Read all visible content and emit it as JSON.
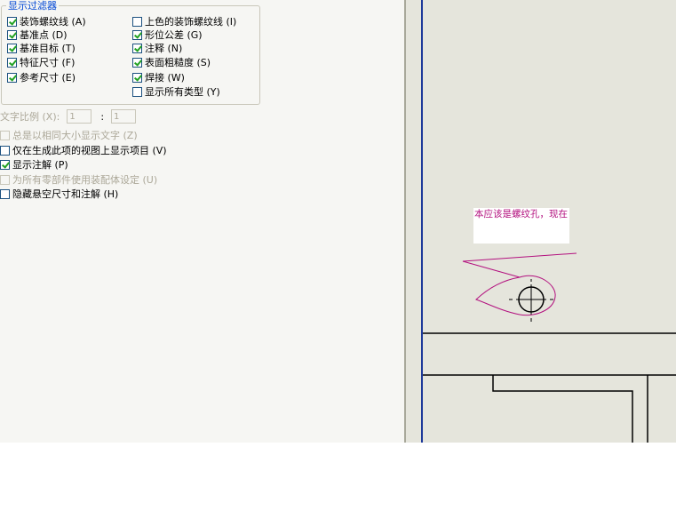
{
  "display_filter": {
    "title": "显示过滤器",
    "left_items": [
      {
        "label": "装饰螺纹线 (A)",
        "checked": true
      },
      {
        "label": "基准点 (D)",
        "checked": true
      },
      {
        "label": "基准目标 (T)",
        "checked": true
      },
      {
        "label": "特征尺寸 (F)",
        "checked": true
      },
      {
        "label": "参考尺寸 (E)",
        "checked": true
      }
    ],
    "right_items": [
      {
        "label": "上色的装饰螺纹线 (I)",
        "checked": false
      },
      {
        "label": "形位公差 (G)",
        "checked": true
      },
      {
        "label": "注释 (N)",
        "checked": true
      },
      {
        "label": "表面粗糙度 (S)",
        "checked": true
      },
      {
        "label": "焊接 (W)",
        "checked": true
      },
      {
        "label": "显示所有类型 (Y)",
        "checked": false
      }
    ]
  },
  "text_scale": {
    "label": "文字比例 (X):",
    "value1": "1",
    "separator": ":",
    "value2": "1"
  },
  "options": [
    {
      "label": "总是以相同大小显示文字 (Z)",
      "checked": false,
      "disabled": true
    },
    {
      "label": "仅在生成此项的视图上显示项目 (V)",
      "checked": false,
      "disabled": false
    },
    {
      "label": "显示注解 (P)",
      "checked": true,
      "disabled": false
    },
    {
      "label": "为所有零部件使用装配体设定 (U)",
      "checked": false,
      "disabled": true
    },
    {
      "label": "隐藏悬空尺寸和注解 (H)",
      "checked": false,
      "disabled": false
    }
  ],
  "drawing": {
    "note_text": "本应该是螺纹孔，现在",
    "annotation_color": "#b3117f",
    "border_color": "#1e3a9a"
  }
}
